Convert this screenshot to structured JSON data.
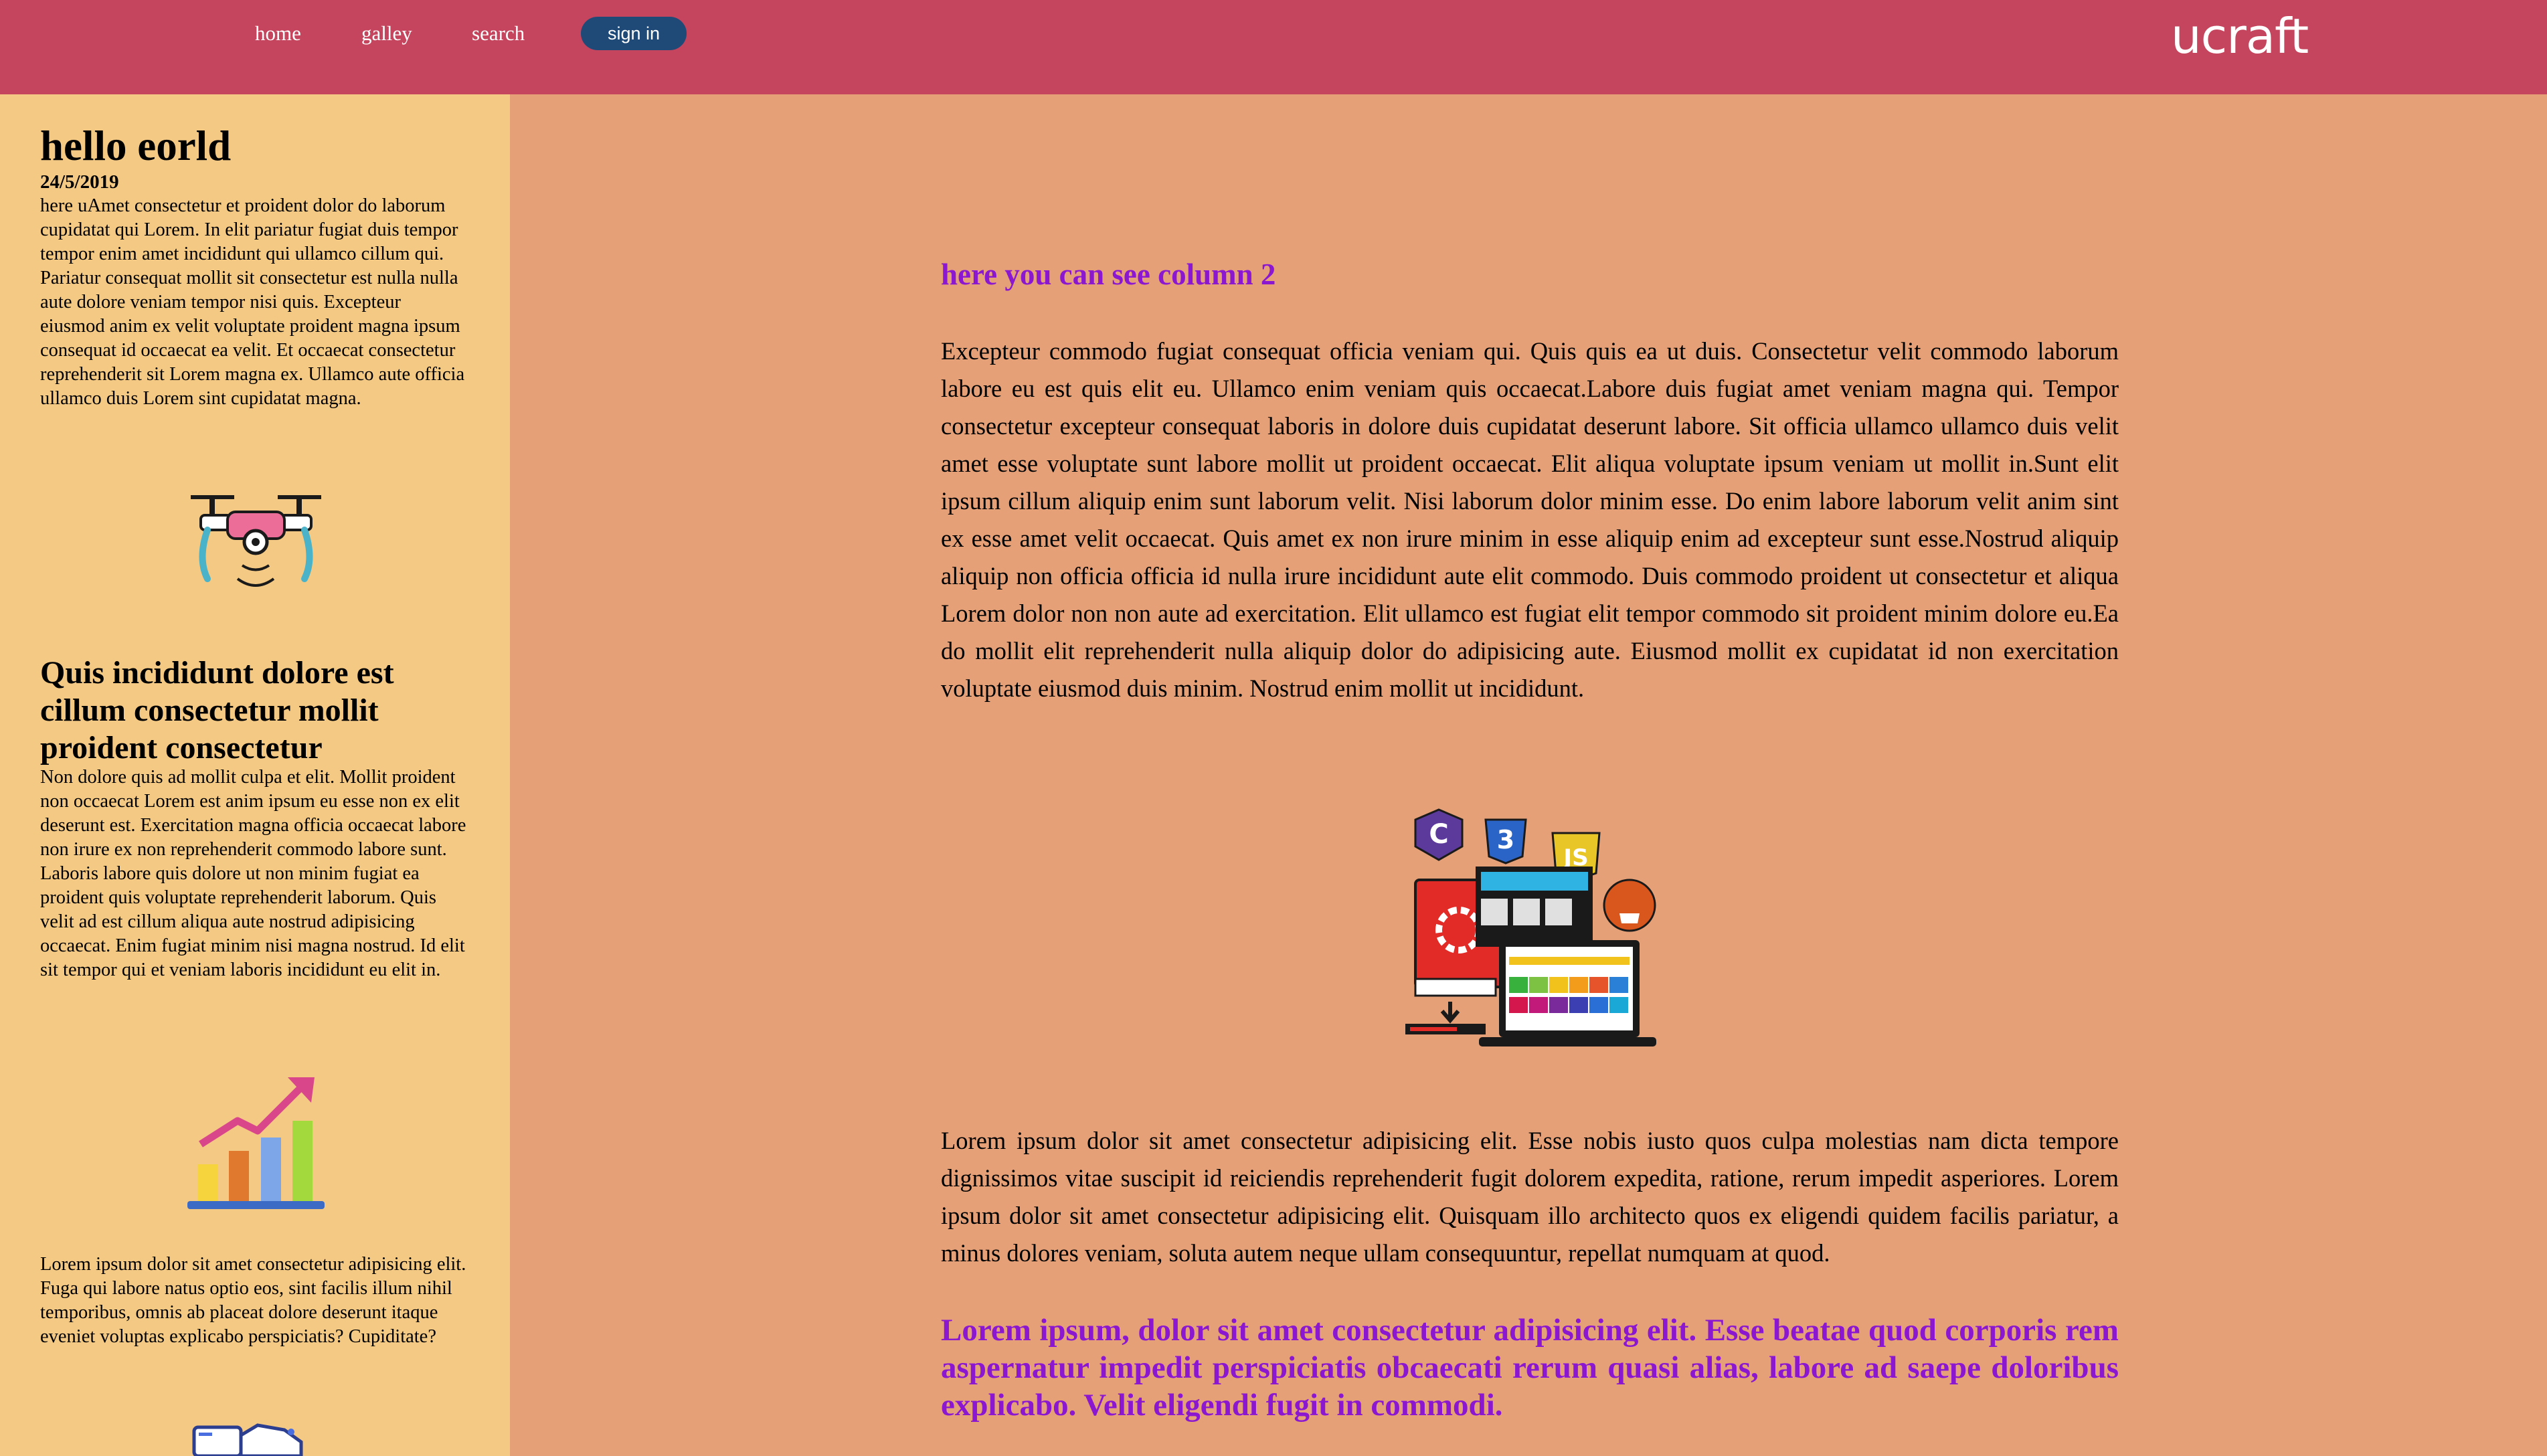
{
  "nav": {
    "home": "home",
    "gallery": "galley",
    "search": "search",
    "signin": "sign in",
    "logo": "ucraft"
  },
  "sidebar": {
    "title": "hello eorld",
    "date": "24/5/2019",
    "intro": "here uAmet consectetur et proident dolor do laborum cupidatat qui Lorem. In elit pariatur fugiat duis tempor tempor enim amet incididunt qui ullamco cillum qui. Pariatur consequat mollit sit consectetur est nulla nulla aute dolore veniam tempor nisi quis. Excepteur eiusmod anim ex velit voluptate proident magna ipsum consequat id occaecat ea velit. Et occaecat consectetur reprehenderit sit Lorem magna ex. Ullamco aute officia ullamco duis Lorem sint cupidatat magna.",
    "section_title": "Quis incididunt dolore est cillum consectetur mollit proident consectetur",
    "section_text": "Non dolore quis ad mollit culpa et elit. Mollit proident non occaecat Lorem est anim ipsum eu esse non ex elit deserunt est. Exercitation magna officia occaecat labore non irure ex non reprehenderit commodo labore sunt. Laboris labore quis dolore ut non minim fugiat ea proident quis voluptate reprehenderit laborum. Quis velit ad est cillum aliqua aute nostrud adipisicing occaecat. Enim fugiat minim nisi magna nostrud. Id elit sit tempor qui et veniam laboris incididunt eu elit in.",
    "footer_text": "Lorem ipsum dolor sit amet consectetur adipisicing elit. Fuga qui labore natus optio eos, sint facilis illum nihil temporibus, omnis ab placeat dolore deserunt itaque eveniet voluptas explicabo perspiciatis? Cupiditate?",
    "icons": [
      "drone-icon",
      "growth-chart-icon",
      "web-design-icon"
    ]
  },
  "main": {
    "heading": "here you can see column 2",
    "paragraph1": "Excepteur commodo fugiat consequat officia veniam qui. Quis quis ea ut duis. Consectetur velit commodo laborum labore eu est quis elit eu. Ullamco enim veniam quis occaecat.Labore duis fugiat amet veniam magna qui. Tempor consectetur excepteur consequat laboris in dolore duis cupidatat deserunt labore. Sit officia ullamco ullamco duis velit amet esse voluptate sunt labore mollit ut proident occaecat. Elit aliqua voluptate ipsum veniam ut mollit in.Sunt elit ipsum cillum aliquip enim sunt laborum velit. Nisi laborum dolor minim esse. Do enim labore laborum velit anim sint ex esse amet velit occaecat. Quis amet ex non irure minim in esse aliquip enim ad excepteur sunt esse.Nostrud aliquip aliquip non officia officia id nulla irure incididunt aute elit commodo. Duis commodo proident ut consectetur et aliqua Lorem dolor non non aute ad exercitation. Elit ullamco est fugiat elit tempor commodo sit proident minim dolore eu.Ea do mollit elit reprehenderit nulla aliquip dolor do adipisicing aute. Eiusmod mollit ex cupidatat id non exercitation voluptate eiusmod duis minim. Nostrud enim mollit ut incididunt.",
    "paragraph2": "Lorem ipsum dolor sit amet consectetur adipisicing elit. Esse nobis iusto quos culpa molestias nam dicta tempore dignissimos vitae suscipit id reiciendis reprehenderit fugit dolorem expedita, ratione, rerum impedit asperiores. Lorem ipsum dolor sit amet consectetur adipisicing elit. Quisquam illo architecto quos ex eligendi quidem facilis pariatur, a minus dolores veniam, soluta autem neque ullam consequuntur, repellat numquam at quod.",
    "emphasis": "Lorem ipsum, dolor sit amet consectetur adipisicing elit. Esse beatae quod corporis rem aspernatur impedit perspiciatis obcaecati rerum quasi alias, labore ad saepe doloribus explicabo. Velit eligendi fugit in commodi.",
    "illustration": "web-development-icon",
    "illustration_badges": [
      "C",
      "3",
      "JS"
    ]
  },
  "colors": {
    "header": "#c4455d",
    "sidebar": "#f4c984",
    "main": "#e6a078",
    "accent": "#8b17d1",
    "button": "#1f4a78"
  }
}
